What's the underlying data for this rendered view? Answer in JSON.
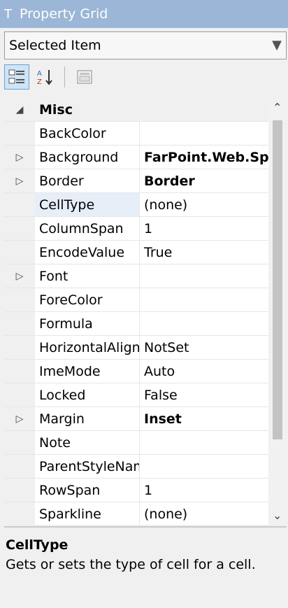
{
  "titlebar": {
    "pin": "Τ",
    "title": "Property Grid"
  },
  "selector": {
    "value": "Selected Item",
    "chevron": "▼"
  },
  "toolbar": {
    "categorized_icon": "categorized-icon",
    "alphabetical_icon": "alphabetical-icon",
    "property_pages_icon": "property-pages-icon"
  },
  "grid": {
    "category": "Misc",
    "rows": [
      {
        "name": "BackColor",
        "value": "",
        "expandable": false,
        "bold": false
      },
      {
        "name": "Background",
        "value": "FarPoint.Web.Sp",
        "expandable": true,
        "bold": true
      },
      {
        "name": "Border",
        "value": "Border",
        "expandable": true,
        "bold": true
      },
      {
        "name": "CellType",
        "value": "(none)",
        "expandable": false,
        "bold": false,
        "selected": true
      },
      {
        "name": "ColumnSpan",
        "value": "1",
        "expandable": false,
        "bold": false
      },
      {
        "name": "EncodeValue",
        "value": "True",
        "expandable": false,
        "bold": false
      },
      {
        "name": "Font",
        "value": "",
        "expandable": true,
        "bold": false
      },
      {
        "name": "ForeColor",
        "value": "",
        "expandable": false,
        "bold": false
      },
      {
        "name": "Formula",
        "value": "",
        "expandable": false,
        "bold": false
      },
      {
        "name": "HorizontalAlign",
        "value": "NotSet",
        "expandable": false,
        "bold": false
      },
      {
        "name": "ImeMode",
        "value": "Auto",
        "expandable": false,
        "bold": false
      },
      {
        "name": "Locked",
        "value": "False",
        "expandable": false,
        "bold": false
      },
      {
        "name": "Margin",
        "value": "Inset",
        "expandable": true,
        "bold": true
      },
      {
        "name": "Note",
        "value": "",
        "expandable": false,
        "bold": false
      },
      {
        "name": "ParentStyleName",
        "value": "",
        "expandable": false,
        "bold": false
      },
      {
        "name": "RowSpan",
        "value": "1",
        "expandable": false,
        "bold": false
      },
      {
        "name": "Sparkline",
        "value": "(none)",
        "expandable": false,
        "bold": false
      }
    ]
  },
  "description": {
    "title": "CellType",
    "text": "Gets or sets the type of cell for a cell."
  }
}
